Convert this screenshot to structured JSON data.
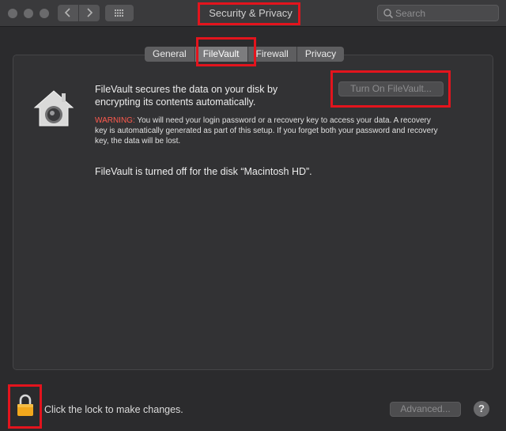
{
  "window": {
    "title": "Security & Privacy"
  },
  "toolbar": {
    "back_icon": "chevron-left-icon",
    "forward_icon": "chevron-right-icon",
    "show_all_icon": "grid-icon",
    "search_placeholder": "Search"
  },
  "tabs": [
    {
      "label": "General",
      "active": false
    },
    {
      "label": "FileVault",
      "active": true
    },
    {
      "label": "Firewall",
      "active": false
    },
    {
      "label": "Privacy",
      "active": false
    }
  ],
  "filevault": {
    "description": "FileVault secures the data on your disk by encrypting its contents automatically.",
    "turn_on_label": "Turn On FileVault...",
    "warning_label": "WARNING:",
    "warning_text": " You will need your login password or a recovery key to access your data. A recovery key is automatically generated as part of this setup. If you forget both your password and recovery key, the data will be lost.",
    "status": "FileVault is turned off for the disk “Macintosh HD”."
  },
  "footer": {
    "lock_text": "Click the lock to make changes.",
    "advanced_label": "Advanced...",
    "help_label": "?"
  },
  "colors": {
    "annotation": "#e3141d",
    "warning": "#ff5a4e",
    "background": "#2b2b2d"
  }
}
